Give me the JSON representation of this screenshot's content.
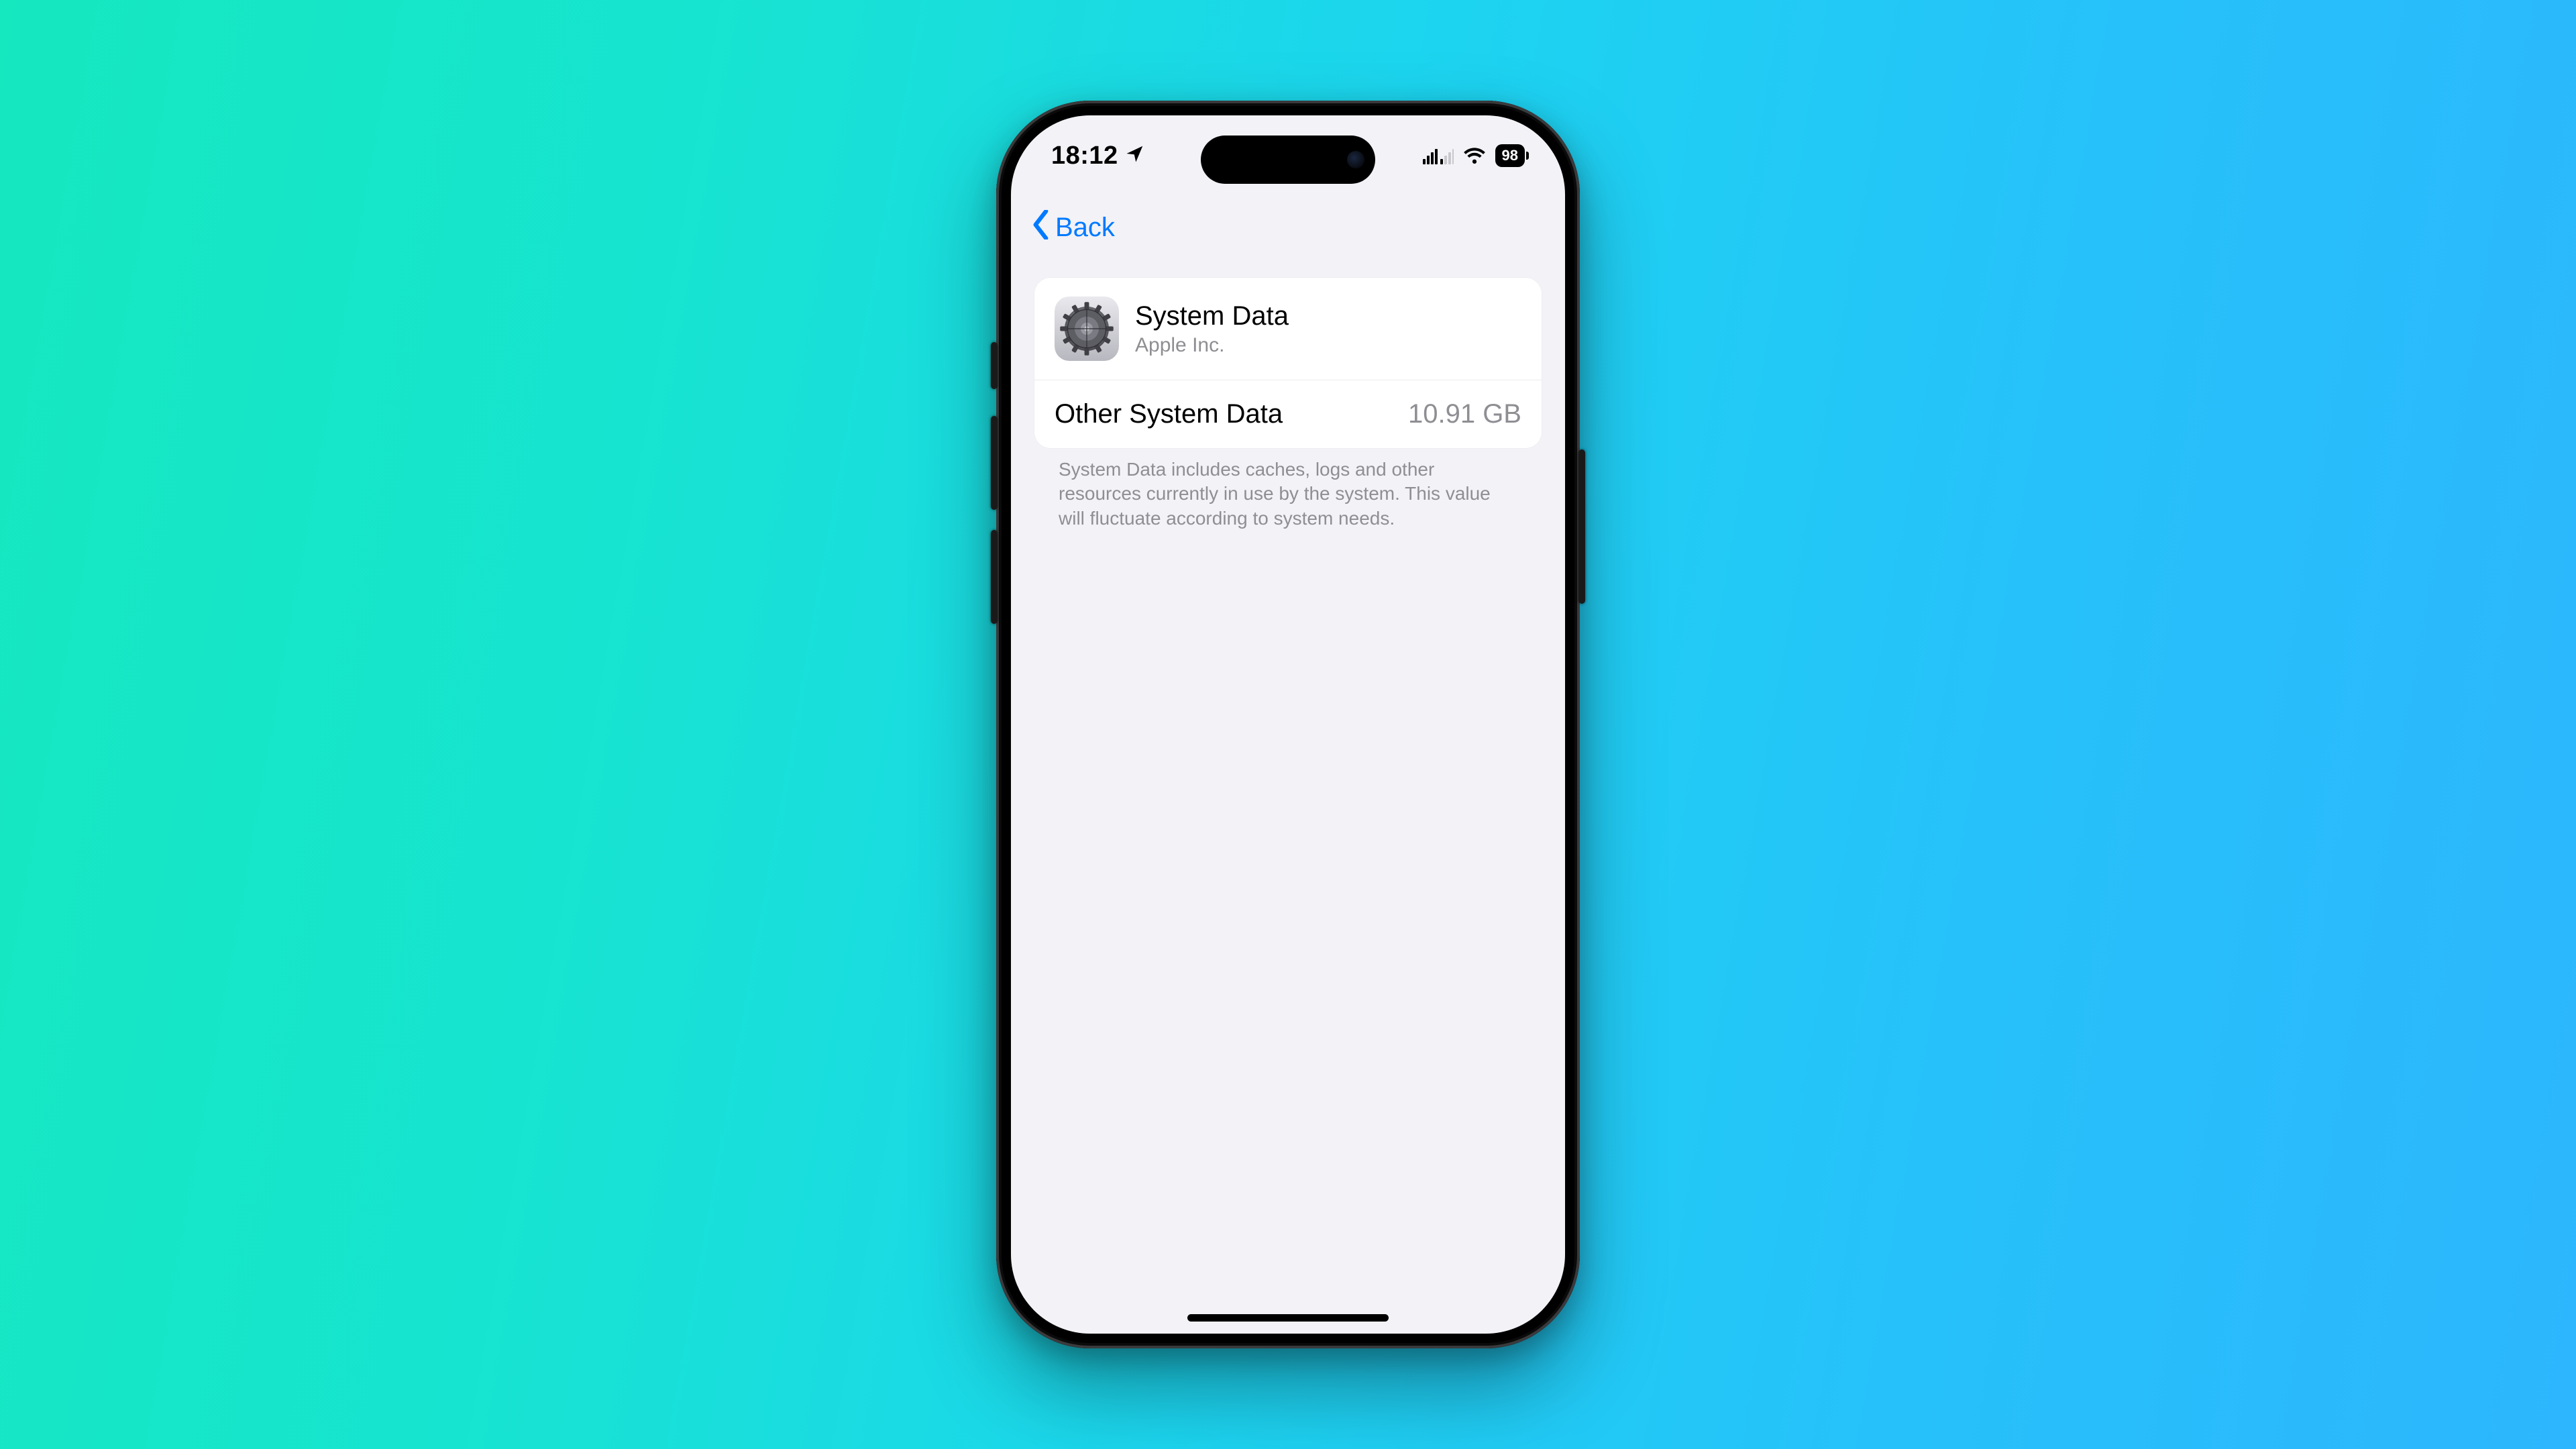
{
  "status": {
    "time": "18:12",
    "location_icon": "location-arrow",
    "battery_text": "98"
  },
  "nav": {
    "back_label": "Back"
  },
  "header": {
    "title": "System Data",
    "subtitle": "Apple Inc."
  },
  "row": {
    "label": "Other System Data",
    "value": "10.91 GB"
  },
  "footer_note": "System Data includes caches, logs and other resources currently in use by the system. This value will fluctuate according to system needs.",
  "colors": {
    "accent": "#007aff",
    "bg": "#f2f2f7",
    "secondary_text": "#8e8e93"
  }
}
